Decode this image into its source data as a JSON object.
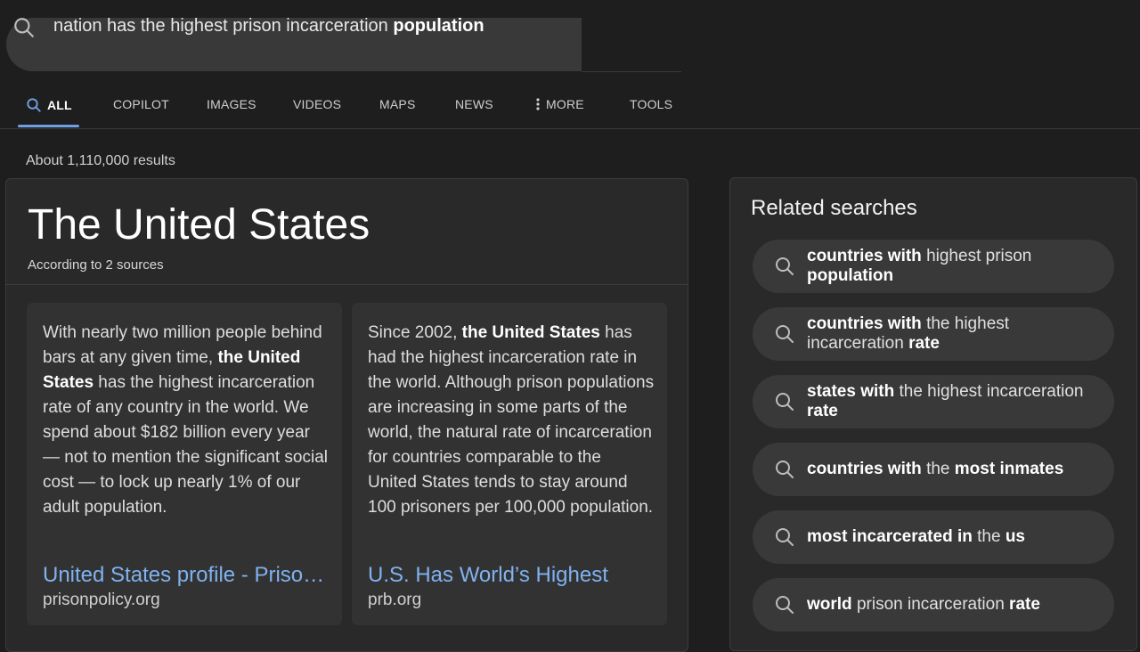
{
  "search": {
    "query_plain": "nation has the highest prison incarceration ",
    "query_bold": "population"
  },
  "tabs": [
    {
      "label": "ALL"
    },
    {
      "label": "COPILOT"
    },
    {
      "label": "IMAGES"
    },
    {
      "label": "VIDEOS"
    },
    {
      "label": "MAPS"
    },
    {
      "label": "NEWS"
    },
    {
      "label": "MORE"
    },
    {
      "label": "TOOLS"
    }
  ],
  "results_count": "About 1,110,000 results",
  "answer": {
    "title": "The United States",
    "subtitle": "According to 2 sources",
    "sources": [
      {
        "p1": "With nearly two million people behind bars at any given time, ",
        "b1": "the United States",
        "p2": " has the highest incarceration rate of any country in the world. We spend about $182 billion every year — not to mention the significant social cost — to lock up nearly 1% of our adult population.",
        "link": "United States profile - Prison Policy Initiative",
        "domain": "prisonpolicy.org"
      },
      {
        "p1": "Since 2002, ",
        "b1": "the United States",
        "p2": " has had the highest incarceration rate in the world. Although prison populations are increasing in some parts of the world, the natural rate of incarceration for countries comparable to the United States tends to stay around 100 prisoners per 100,000 population.",
        "link": "U.S. Has World’s Highest",
        "domain": "prb.org"
      }
    ]
  },
  "related": {
    "title": "Related searches",
    "items": [
      {
        "b1": "countries with",
        "p1": " highest prison ",
        "b2": "population",
        "p2": ""
      },
      {
        "b1": "countries with",
        "p1": " the highest incarceration ",
        "b2": "rate",
        "p2": ""
      },
      {
        "b1": "states with",
        "p1": " the highest incarceration ",
        "b2": "rate",
        "p2": ""
      },
      {
        "b1": "countries with",
        "p1": " the ",
        "b2": "most inmates",
        "p2": ""
      },
      {
        "b1": "most incarcerated in",
        "p1": " the ",
        "b2": "us",
        "p2": ""
      },
      {
        "b1": "world",
        "p1": " prison incarceration ",
        "b2": "rate",
        "p2": ""
      }
    ]
  },
  "colors": {
    "accent": "#6ea0e6",
    "link": "#7fb2ef",
    "background": "#1f1e1e"
  }
}
